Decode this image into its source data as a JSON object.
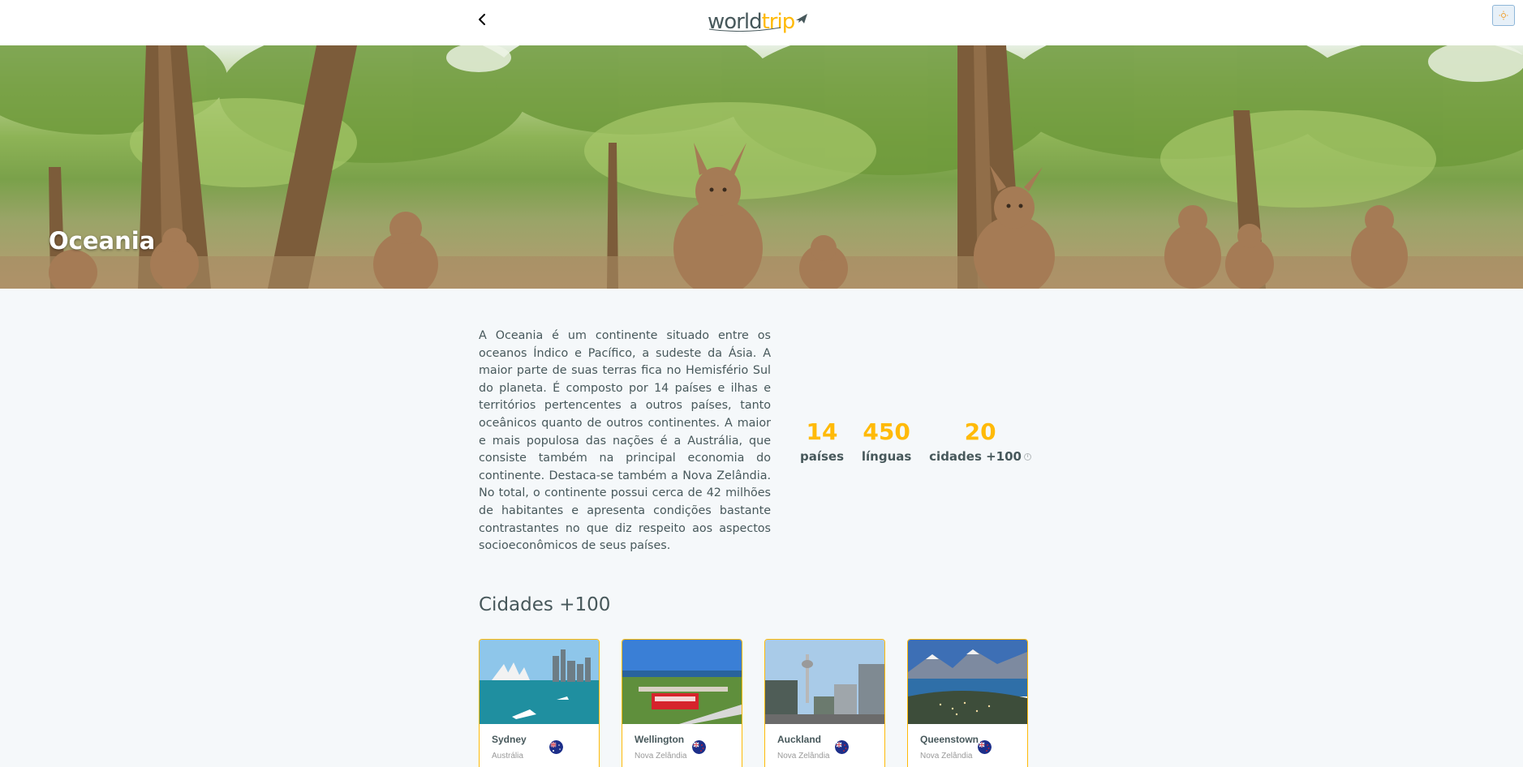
{
  "header": {
    "back_label": "Voltar",
    "logo_part1": "world",
    "logo_part2": "trip"
  },
  "banner": {
    "title": "Oceania"
  },
  "description": "A Oceania é um continente situado entre os oceanos Índico e Pacífico, a sudeste da Ásia. A maior parte de suas terras fica no Hemisfério Sul do planeta. É composto por 14 países e ilhas e territórios pertencentes a outros países, tanto oceânicos quanto de outros continentes. A maior e mais populosa das nações é a Austrália, que consiste também na principal economia do continente. Destaca-se também a Nova Zelândia. No total, o continente possui cerca de 42 milhões de habitantes e apresenta condições bastante contrastantes no que diz respeito aos aspectos socioeconômicos de seus países.",
  "stats": [
    {
      "value": "14",
      "label": "países"
    },
    {
      "value": "450",
      "label": "línguas"
    },
    {
      "value": "20",
      "label": "cidades +100"
    }
  ],
  "cities_title": "Cidades +100",
  "cities": [
    {
      "name": "Sydney",
      "country": "Austrália",
      "flag": "australia-flag-icon"
    },
    {
      "name": "Wellington",
      "country": "Nova Zelândia",
      "flag": "new-zealand-flag-icon"
    },
    {
      "name": "Auckland",
      "country": "Nova Zelândia",
      "flag": "new-zealand-flag-icon"
    },
    {
      "name": "Queenstown",
      "country": "Nova Zelândia",
      "flag": "new-zealand-flag-icon"
    }
  ],
  "colors": {
    "highlight": "#ffba08",
    "text": "#47585b",
    "background": "#f5f8fa"
  }
}
